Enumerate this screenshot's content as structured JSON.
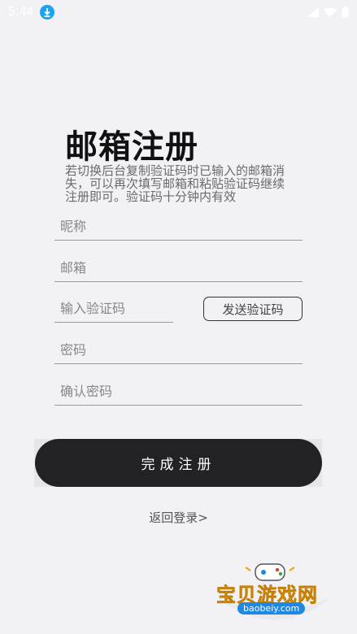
{
  "status_bar": {
    "time": "5:44"
  },
  "page": {
    "title": "邮箱注册",
    "description": "若切换后台复制验证码时已输入的邮箱消失，可以再次填写邮箱和粘贴验证码继续注册即可。验证码十分钟内有效"
  },
  "form": {
    "nickname_placeholder": "昵称",
    "email_placeholder": "邮箱",
    "code_placeholder": "输入验证码",
    "send_code_label": "发送验证码",
    "password_placeholder": "密码",
    "confirm_password_placeholder": "确认密码",
    "submit_label": "完成注册"
  },
  "back_link": "返回登录>",
  "watermark": {
    "text": "宝贝游戏网",
    "url": "baobeiy.com"
  },
  "colors": {
    "background": "#f2f1f6",
    "button": "#222225",
    "download_badge": "#1fa3f0",
    "watermark": "#f2a400"
  }
}
